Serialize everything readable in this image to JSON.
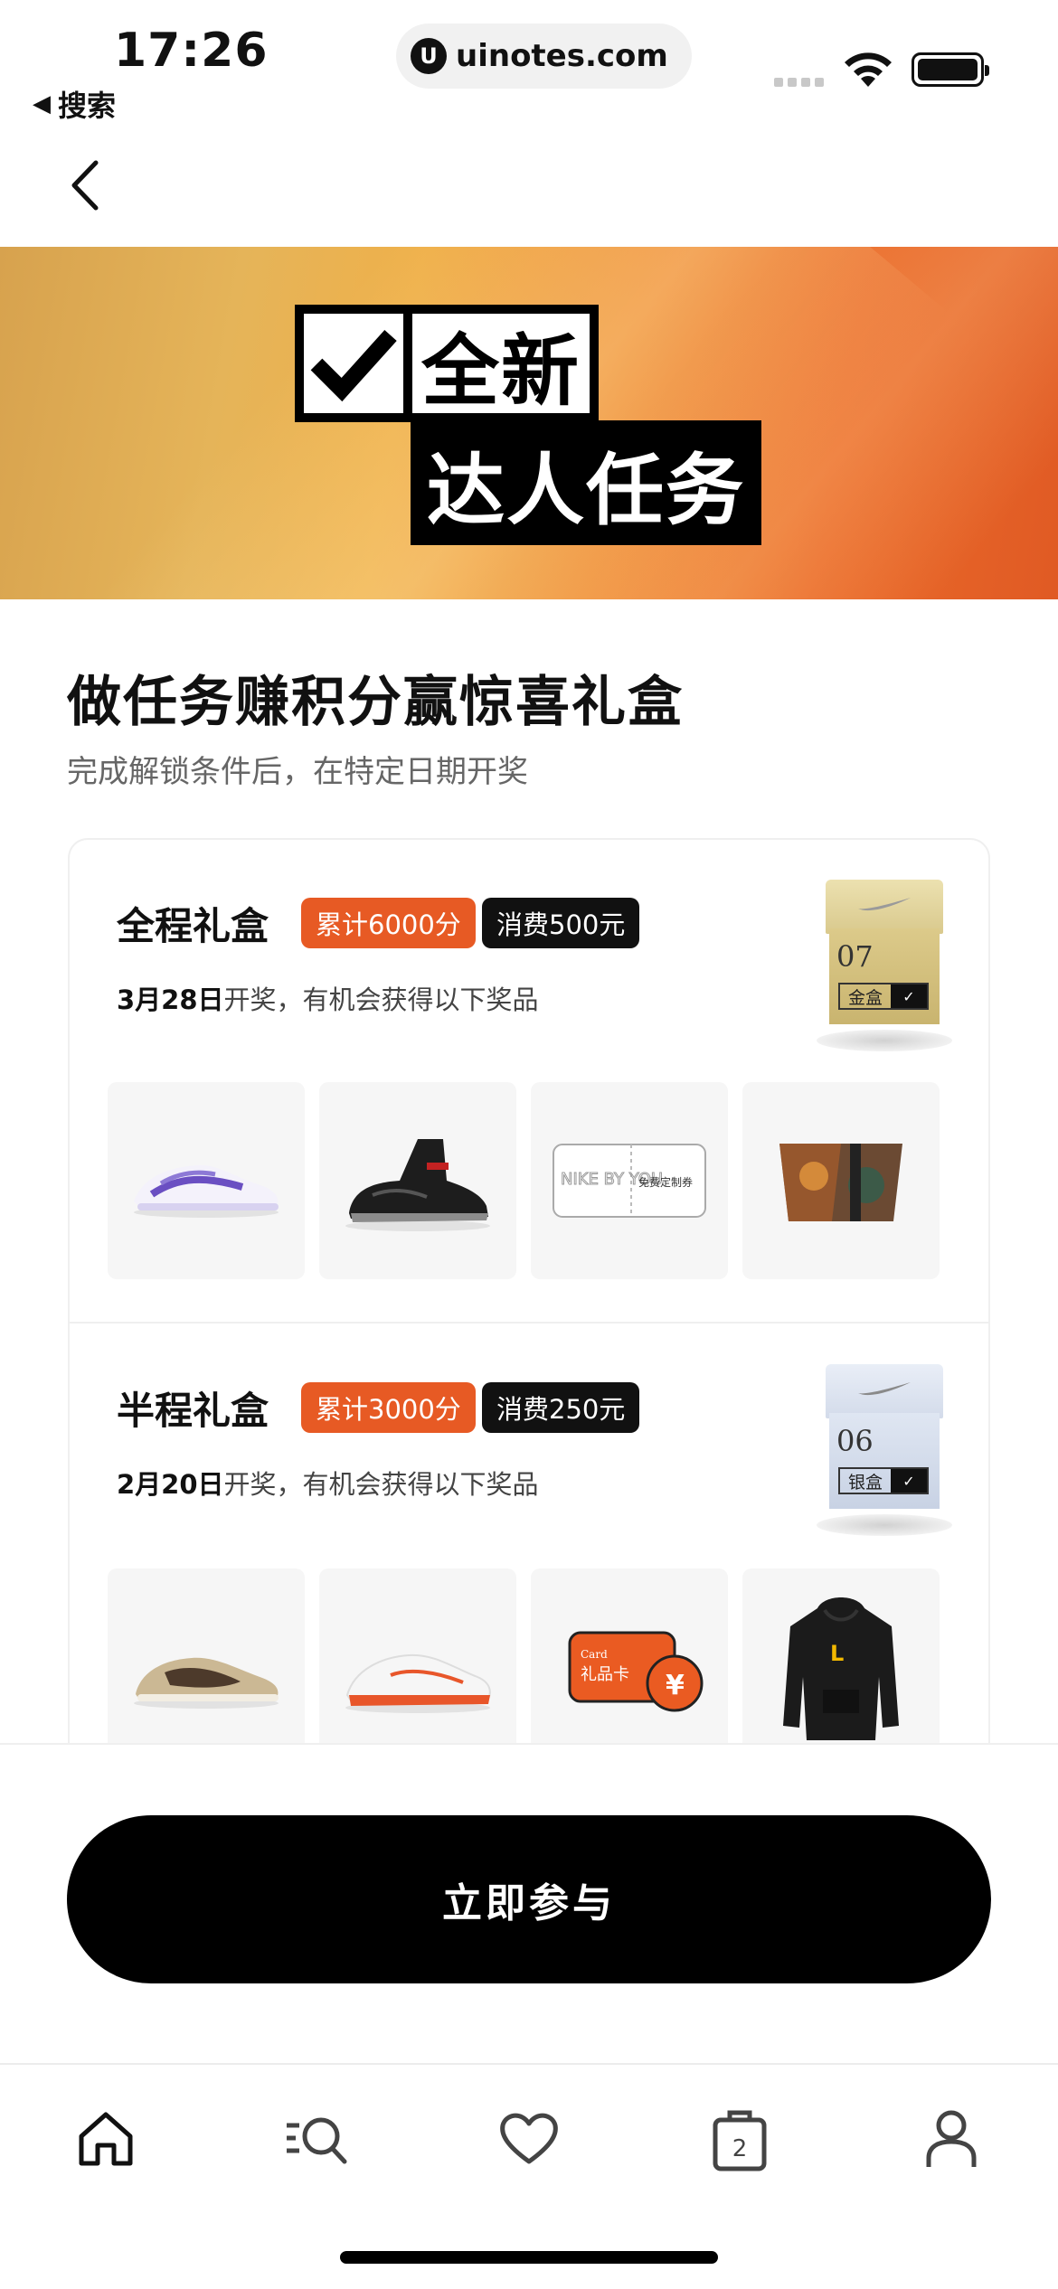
{
  "status_bar": {
    "time": "17:26",
    "back_label": "搜索",
    "url": "uinotes.com",
    "url_logo": "U"
  },
  "banner": {
    "title_line1": "全新",
    "title_line2": "达人任务"
  },
  "heading": "做任务赚积分赢惊喜礼盒",
  "subheading": "完成解锁条件后，在特定日期开奖",
  "boxes": [
    {
      "title": "全程礼盒",
      "tag_points": "累计6000分",
      "tag_spend": "消费500元",
      "draw_date": "3月28日",
      "draw_text": "开奖，有机会获得以下奖品",
      "box_number": "07",
      "box_label": "金盒",
      "products": [
        "purple-white-sneaker",
        "black-red-sneaker",
        "nike-by-you-voucher",
        "printed-tote-bag"
      ],
      "voucher_text_a": "NIKE BY YOU",
      "voucher_text_b": "免费定制券"
    },
    {
      "title": "半程礼盒",
      "tag_points": "累计3000分",
      "tag_spend": "消费250元",
      "draw_date": "2月20日",
      "draw_text": "开奖，有机会获得以下奖品",
      "box_number": "06",
      "box_label": "银盒",
      "products": [
        "beige-brown-sneaker",
        "white-orange-sneaker",
        "gift-card",
        "black-hoodie"
      ],
      "gift_card_text_a": "Card",
      "gift_card_text_b": "礼品卡",
      "gift_card_symbol": "¥"
    }
  ],
  "cta_label": "立即参与",
  "tabbar": {
    "items": [
      "home-icon",
      "search-list-icon",
      "heart-icon",
      "bag-icon",
      "profile-icon"
    ],
    "bag_count": "2"
  }
}
